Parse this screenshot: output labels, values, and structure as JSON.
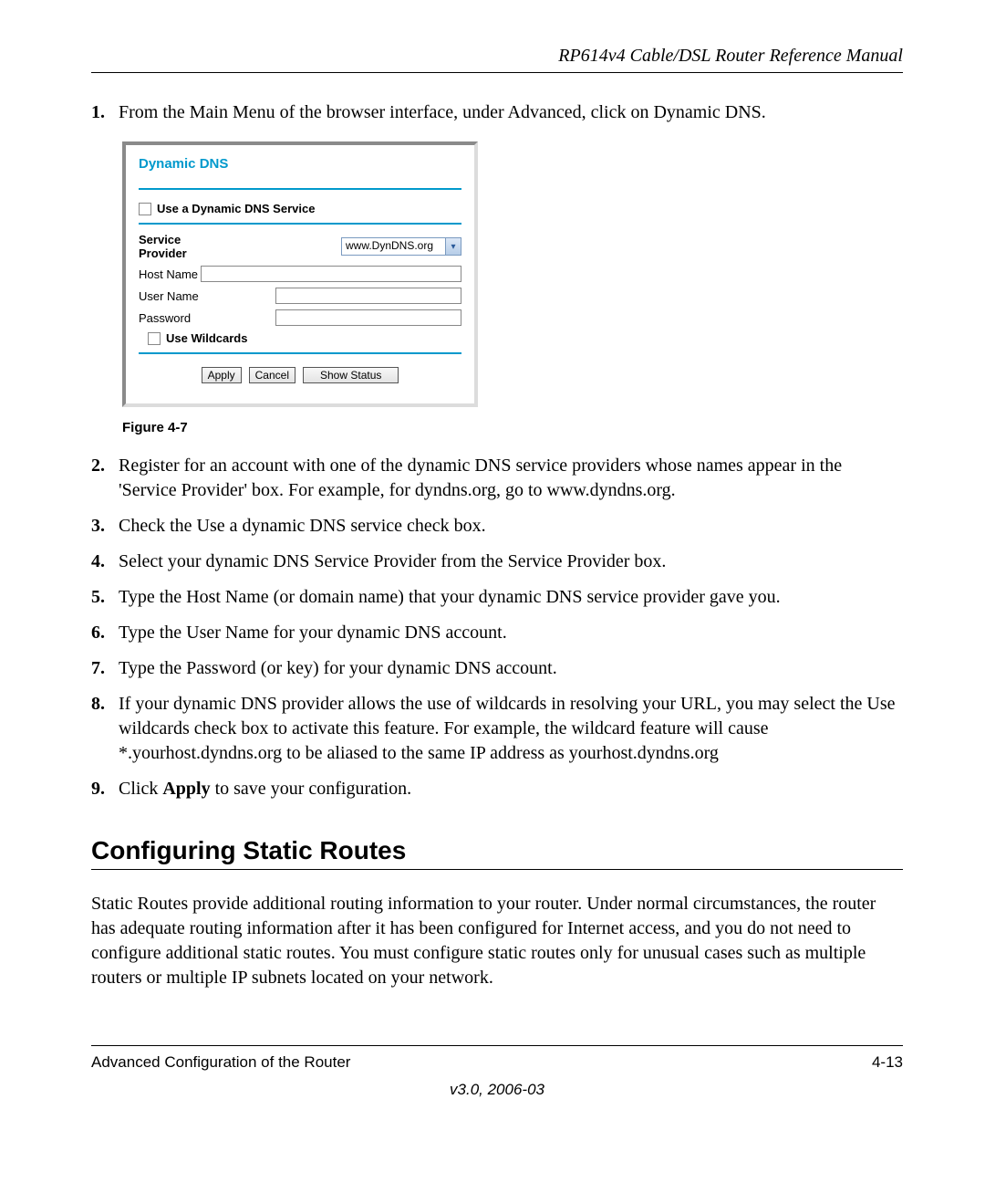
{
  "header": {
    "title": "RP614v4 Cable/DSL Router Reference Manual"
  },
  "steps": {
    "s1": {
      "n": "1.",
      "t": "From the Main Menu of the browser interface, under Advanced, click on Dynamic DNS."
    },
    "s2": {
      "n": "2.",
      "t": "Register for an account with one of the dynamic DNS service providers whose names appear in the 'Service Provider' box. For example, for dyndns.org, go to www.dyndns.org."
    },
    "s3": {
      "n": "3.",
      "t": "Check the Use a dynamic DNS service check box."
    },
    "s4": {
      "n": "4.",
      "t": "Select your dynamic DNS Service Provider from the Service Provider box."
    },
    "s5": {
      "n": "5.",
      "t": "Type the Host Name (or domain name) that your dynamic DNS service provider gave you."
    },
    "s6": {
      "n": "6.",
      "t": "Type the User Name for your dynamic DNS account."
    },
    "s7": {
      "n": "7.",
      "t": "Type the Password (or key) for your dynamic DNS account."
    },
    "s8": {
      "n": "8.",
      "t": "If your dynamic DNS provider allows the use of wildcards in resolving your URL, you may select the Use wildcards check box to activate this feature. For example, the wildcard feature will cause *.yourhost.dyndns.org to be aliased to the same IP address as yourhost.dyndns.org"
    },
    "s9": {
      "n": "9.",
      "pre": "Click ",
      "bold": "Apply",
      "post": " to save your configuration."
    }
  },
  "panel": {
    "title": "Dynamic DNS",
    "use_service": "Use a Dynamic DNS Service",
    "service_provider_label": "Service Provider",
    "service_provider_value": "www.DynDNS.org",
    "host_name_label": "Host Name",
    "user_name_label": "User Name",
    "password_label": "Password",
    "use_wildcards": "Use Wildcards",
    "buttons": {
      "apply": "Apply",
      "cancel": "Cancel",
      "show_status": "Show Status"
    }
  },
  "figure_caption": "Figure 4-7",
  "section_heading": "Configuring Static Routes",
  "section_body": "Static Routes provide additional routing information to your router. Under normal circumstances, the router has adequate routing information after it has been configured for Internet access, and you do not need to configure additional static routes. You must configure static routes only for unusual cases such as multiple routers or multiple IP subnets located on your network.",
  "footer": {
    "left": "Advanced Configuration of the Router",
    "right": "4-13",
    "version": "v3.0, 2006-03"
  }
}
